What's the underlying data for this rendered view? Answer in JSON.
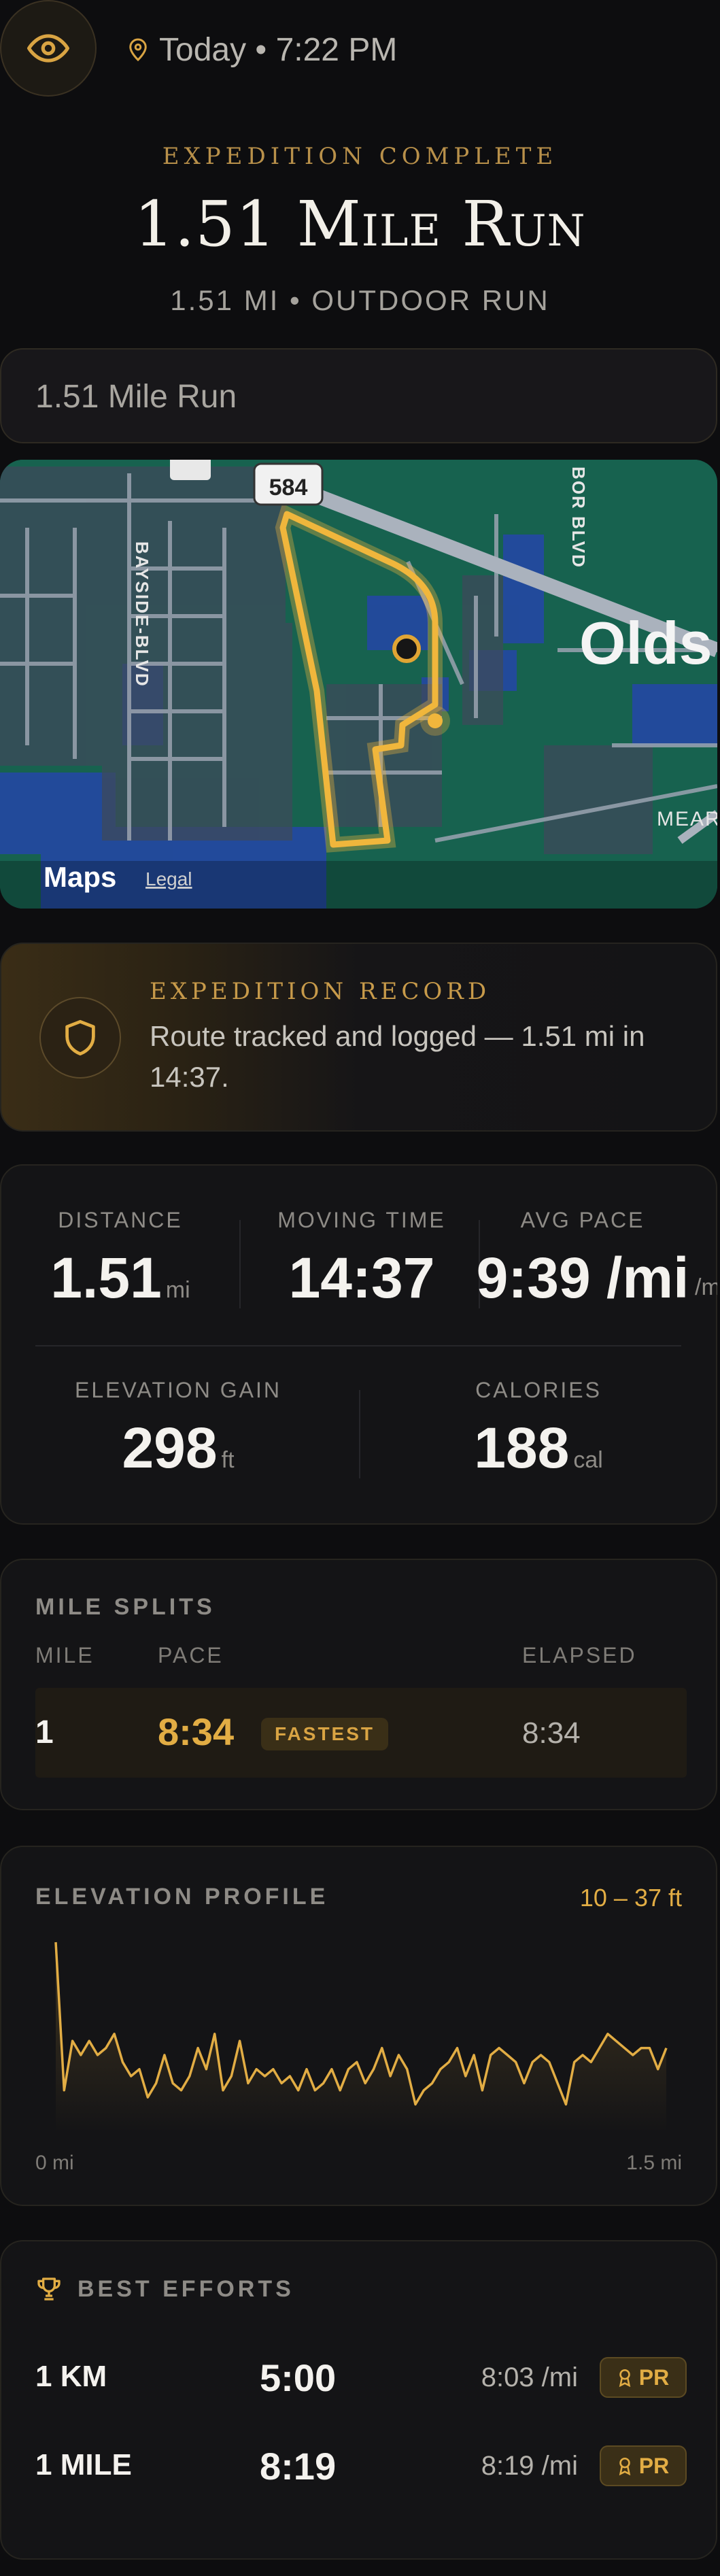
{
  "header": {
    "eye_icon": "eye-icon",
    "location_icon": "pin-icon",
    "datetime": "Today • 7:22 PM",
    "kicker": "EXPEDITION COMPLETE",
    "title": "1.51 Mile Run",
    "subtitle": "1.51 MI • OUTDOOR RUN"
  },
  "run_name": "1.51 Mile Run",
  "map": {
    "route_shield": "584",
    "street_1": "BAYSIDE-BLVD",
    "street_2": "BOR BLVD",
    "place": "Olds",
    "place_2": "MEAR",
    "attribution": "Maps",
    "legal": "Legal",
    "route_color": "#f0b63c"
  },
  "record": {
    "label": "EXPEDITION RECORD",
    "message": "Route tracked and logged — 1.51 mi in 14:37."
  },
  "stats": {
    "distance": {
      "label": "DISTANCE",
      "value": "1.51",
      "unit": "mi"
    },
    "moving_time": {
      "label": "MOVING TIME",
      "value": "14:37"
    },
    "avg_pace": {
      "label": "AVG PACE",
      "value": "9:39 /mi",
      "unit": "/m"
    },
    "elevation_gain": {
      "label": "ELEVATION GAIN",
      "value": "298",
      "unit": "ft"
    },
    "calories": {
      "label": "CALORIES",
      "value": "188",
      "unit": "cal"
    }
  },
  "splits": {
    "label": "MILE SPLITS",
    "columns": [
      "MILE",
      "PACE",
      "ELAPSED"
    ],
    "rows": [
      {
        "mile": "1",
        "pace": "8:34",
        "badge": "FASTEST",
        "elapsed": "8:34"
      }
    ]
  },
  "elevation": {
    "label": "ELEVATION PROFILE",
    "range": "10 – 37 ft",
    "axis_start": "0 mi",
    "axis_end": "1.5 mi",
    "accent": "#e2ad44"
  },
  "chart_data": {
    "type": "line",
    "title": "ELEVATION PROFILE",
    "ylim": [
      10,
      37
    ],
    "x_start": 0,
    "x_end": 1.5,
    "values": [
      37,
      16,
      23,
      21,
      23,
      21,
      22,
      24,
      20,
      18,
      19,
      15,
      17,
      21,
      17,
      16,
      18,
      22,
      19,
      24,
      16,
      18,
      23,
      17,
      19,
      18,
      19,
      17,
      18,
      16,
      19,
      16,
      17,
      19,
      16,
      19,
      20,
      17,
      19,
      22,
      18,
      21,
      19,
      14,
      16,
      17,
      19,
      20,
      22,
      18,
      21,
      16,
      21,
      22,
      21,
      20,
      17,
      20,
      21,
      20,
      17,
      14,
      20,
      21,
      20,
      22,
      24,
      23,
      22,
      21,
      22,
      22,
      19,
      22
    ]
  },
  "efforts": {
    "label": "BEST EFFORTS",
    "rows": [
      {
        "name": "1 KM",
        "time": "5:00",
        "pace": "8:03 /mi",
        "badge": "PR"
      },
      {
        "name": "1 MILE",
        "time": "8:19",
        "pace": "8:19 /mi",
        "badge": "PR"
      }
    ]
  }
}
